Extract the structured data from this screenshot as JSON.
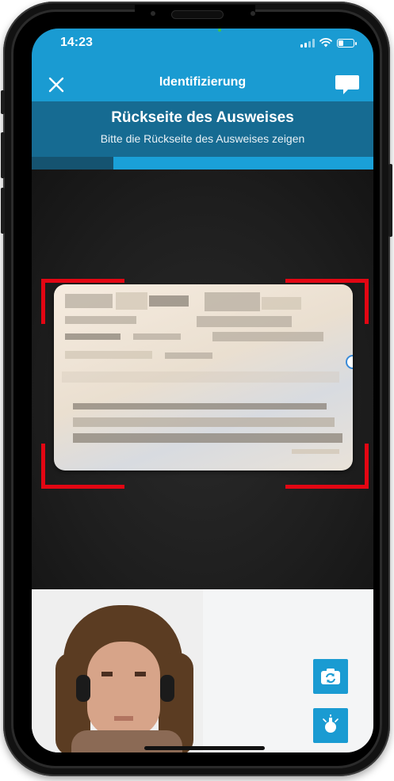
{
  "status_bar": {
    "time": "14:23",
    "signal_icon": "cellular-signal-icon",
    "wifi_icon": "wifi-icon",
    "battery_icon": "battery-icon"
  },
  "app_bar": {
    "title": "Identifizierung",
    "close_icon": "close-icon",
    "chat_icon": "chat-bubble-icon"
  },
  "instruction": {
    "title": "Rückseite des Ausweises",
    "subtitle": "Bitte die Rückseite des Ausweises zeigen"
  },
  "progress": {
    "fraction": 0.76
  },
  "camera_view": {
    "frame_color": "#e30613",
    "card_icon": "id-card-logo-icon"
  },
  "controls": {
    "switch_camera_icon": "switch-camera-icon",
    "flashlight_icon": "flashlight-icon"
  },
  "colors": {
    "primary": "#1a9bd2",
    "banner": "#166b92"
  }
}
